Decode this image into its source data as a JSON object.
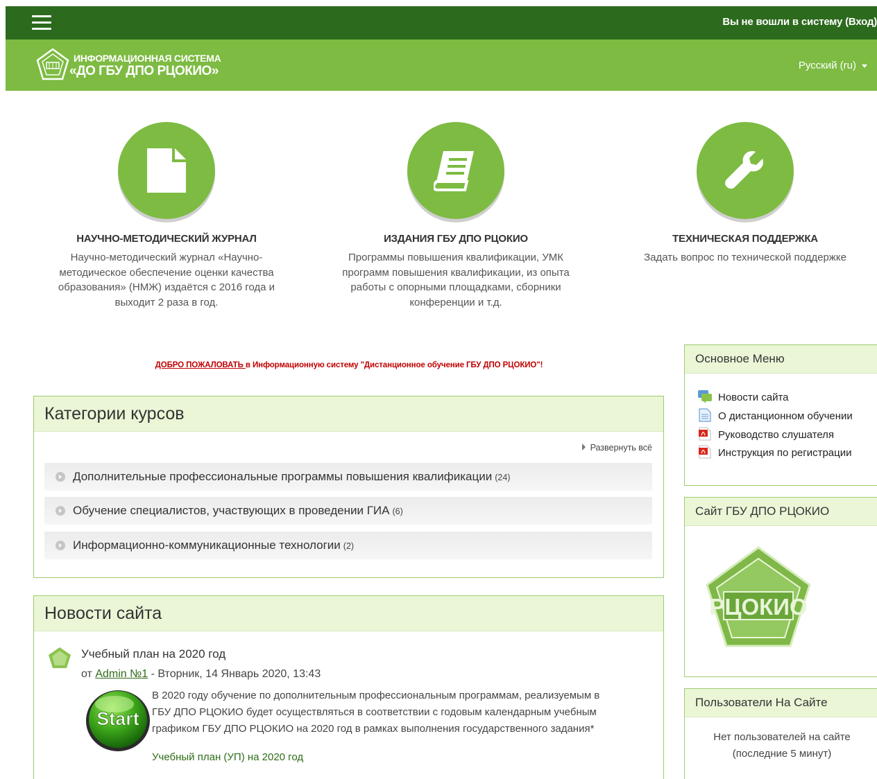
{
  "header": {
    "login_text": "Вы не вошли в систему (Вход)",
    "brand_line1": "ИНФОРМАЦИОННАЯ СИСТЕМА",
    "brand_line2": "«ДО ГБУ ДПО РЦОКИО»",
    "language": "Русский (ru)"
  },
  "features": [
    {
      "icon": "document-icon",
      "title": "НАУЧНО-МЕТОДИЧЕСКИЙ ЖУРНАЛ",
      "lines": [
        "Научно-методический журнал «Научно-",
        "методическое обеспечение оценки качества",
        "образования» (НМЖ) издаётся с 2016 года и",
        "выходит 2 раза в год."
      ]
    },
    {
      "icon": "book-icon",
      "title": "ИЗДАНИЯ ГБУ ДПО РЦОКИО",
      "lines": [
        "Программы повышения квалификации, УМК",
        "программ повышения квалификации, из опыта",
        "работы с опорными площадками, сборники",
        "конференции и т.д."
      ]
    },
    {
      "icon": "wrench-icon",
      "title": "ТЕХНИЧЕСКАЯ ПОДДЕРЖКА",
      "lines": [
        "Задать вопрос по технической поддержке"
      ]
    }
  ],
  "welcome": {
    "link": "ДОБРО ПОЖАЛОВАТЬ ",
    "text": "в Информационную систему \"Дистанционное обучение ГБУ ДПО РЦОКИО\"!"
  },
  "categories": {
    "title": "Категории курсов",
    "expand_all": "Развернуть всё",
    "items": [
      {
        "name": "Дополнительные профессиональные программы повышения квалификации",
        "count": "(24)"
      },
      {
        "name": "Обучение специалистов, участвующих в проведении ГИА",
        "count": "(6)"
      },
      {
        "name": "Информационно-коммуникационные технологии",
        "count": "(2)"
      }
    ]
  },
  "news": {
    "title": "Новости сайта",
    "post": {
      "subject": "Учебный план на 2020 год",
      "by": "от",
      "author": "Admin №1",
      "date": "- Вторник, 14 Январь 2020, 13:43",
      "body": [
        "В 2020 году обучение по дополнительным профессиональным программам, реализуемым в",
        "ГБУ ДПО РЦОКИО будет осуществляться в соответствии с годовым календарным учебным",
        "графиком ГБУ ДПО РЦОКИО на 2020 год в рамках выполнения государственного задания*"
      ],
      "attachment": "Учебный план (УП) на 2020 год",
      "image_text": "Start"
    }
  },
  "sidebar": {
    "main_menu": {
      "title": "Основное Меню",
      "items": [
        {
          "label": "Новости сайта",
          "icon": "forum-icon"
        },
        {
          "label": "О дистанционном обучении",
          "icon": "page-icon"
        },
        {
          "label": "Руководство слушателя",
          "icon": "pdf-icon"
        },
        {
          "label": "Инструкция по регистрации",
          "icon": "pdf-icon"
        }
      ]
    },
    "site": {
      "title": "Сайт ГБУ ДПО РЦОКИО",
      "logo_text": "РЦОКИО"
    },
    "users": {
      "title": "Пользователи На Сайте",
      "lines": [
        "Нет пользователей на сайте",
        "(последние 5 минут)"
      ]
    }
  },
  "colors": {
    "dark_green": "#2c6a1d",
    "green": "#7dbb42",
    "light_green_bg": "#eaf6d6",
    "welcome_red": "#c00000"
  }
}
